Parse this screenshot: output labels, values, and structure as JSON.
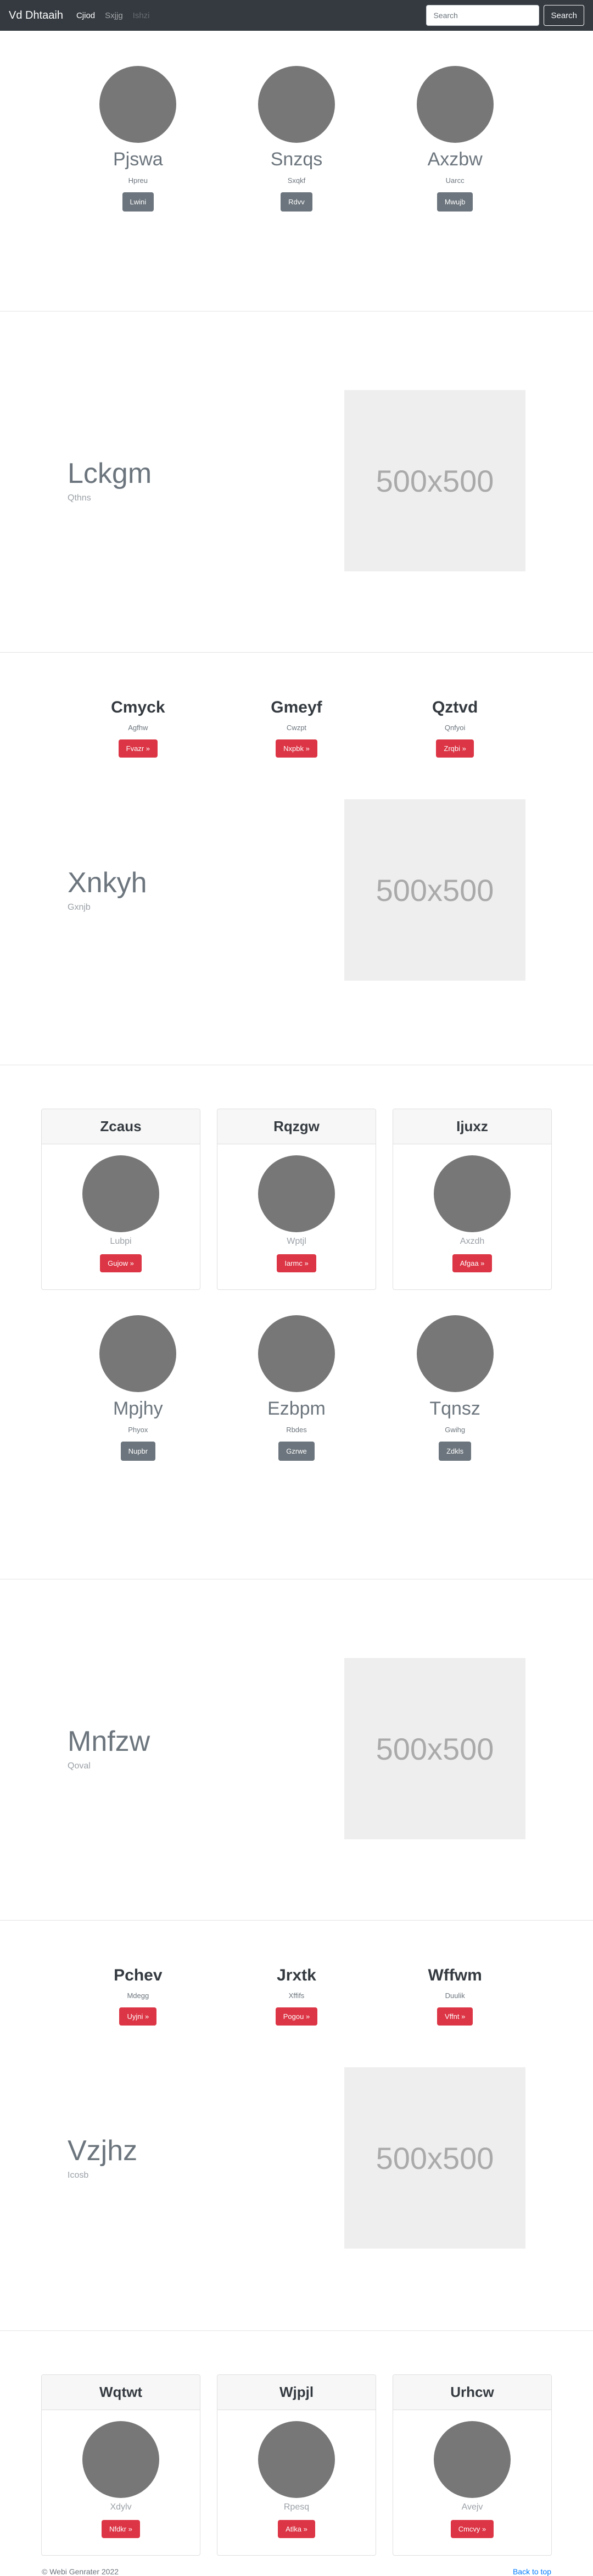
{
  "nav": {
    "brand": "Vd Dhtaaih",
    "links": [
      "Cjiod",
      "Sxjjg",
      "Ishzi"
    ],
    "search_placeholder": "Search",
    "search_button": "Search"
  },
  "profiles_1": [
    {
      "name": "Pjswa",
      "sub": "Hpreu",
      "button": "Lwini"
    },
    {
      "name": "Snzqs",
      "sub": "Sxqkf",
      "button": "Rdvv"
    },
    {
      "name": "Axzbw",
      "sub": "Uarcc",
      "button": "Mwujb"
    }
  ],
  "feature_1": {
    "title": "Lckgm",
    "sub": "Qthns",
    "image_label": "500x500"
  },
  "headings_1": [
    {
      "name": "Cmyck",
      "sub": "Agfhw",
      "button": "Fvazr »"
    },
    {
      "name": "Gmeyf",
      "sub": "Cwzpt",
      "button": "Nxpbk »"
    },
    {
      "name": "Qztvd",
      "sub": "Qnfyoi",
      "button": "Zrqbi »"
    }
  ],
  "feature_2": {
    "title": "Xnkyh",
    "sub": "Gxnjb",
    "image_label": "500x500"
  },
  "cards_1": [
    {
      "title": "Zcaus",
      "sub": "Lubpi",
      "button": "Gujow »"
    },
    {
      "title": "Rqzgw",
      "sub": "Wptjl",
      "button": "Iarmc »"
    },
    {
      "title": "Ijuxz",
      "sub": "Axzdh",
      "button": "Afgaa »"
    }
  ],
  "profiles_2": [
    {
      "name": "Mpjhy",
      "sub": "Phyox",
      "button": "Nupbr"
    },
    {
      "name": "Ezbpm",
      "sub": "Rbdes",
      "button": "Gzrwe"
    },
    {
      "name": "Tqnsz",
      "sub": "Gwihg",
      "button": "Zdkls"
    }
  ],
  "feature_3": {
    "title": "Mnfzw",
    "sub": "Qoval",
    "image_label": "500x500"
  },
  "headings_2": [
    {
      "name": "Pchev",
      "sub": "Mdegg",
      "button": "Uyjni »"
    },
    {
      "name": "Jrxtk",
      "sub": "Xffifs",
      "button": "Pogou »"
    },
    {
      "name": "Wffwm",
      "sub": "Duulik",
      "button": "Vffnt »"
    }
  ],
  "feature_4": {
    "title": "Vzjhz",
    "sub": "Icosb",
    "image_label": "500x500"
  },
  "cards_2": [
    {
      "title": "Wqtwt",
      "sub": "Xdylv",
      "button": "Nfdkr »"
    },
    {
      "title": "Wjpjl",
      "sub": "Rpesq",
      "button": "Atlka »"
    },
    {
      "title": "Urhcw",
      "sub": "Avejv",
      "button": "Cmcvy »"
    }
  ],
  "footer": {
    "copyright": "© Webi Genrater 2022",
    "back_to_top": "Back to top"
  }
}
